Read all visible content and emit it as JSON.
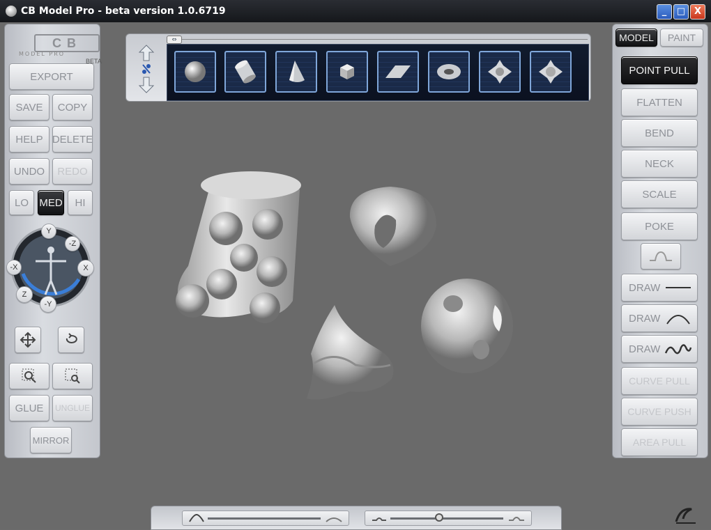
{
  "window": {
    "title": "CB Model Pro - beta version 1.0.6719",
    "controls": [
      "_",
      "□",
      "X"
    ]
  },
  "logo": {
    "brand": "CB",
    "subtitle": "MODEL PRO",
    "badge": "BETA"
  },
  "left_panel": {
    "export": "EXPORT",
    "save": "SAVE",
    "copy": "COPY",
    "help": "HELP",
    "delete": "DELETE",
    "undo": "UNDO",
    "redo": "REDO",
    "lo": "LO",
    "med": "MED",
    "hi": "HI",
    "axes": {
      "y": "Y",
      "neg_z": "-Z",
      "neg_x": "-X",
      "x": "X",
      "z": "Z",
      "neg_y": "-Y"
    },
    "glue": "GLUE",
    "unglue": "UNGLUE",
    "mirror": "MIRROR"
  },
  "right_panel": {
    "tab_model": "MODEL",
    "tab_paint": "PAINT",
    "tools": {
      "point_pull": "POINT PULL",
      "flatten": "FLATTEN",
      "bend": "BEND",
      "neck": "NECK",
      "scale": "SCALE",
      "poke": "POKE",
      "draw_line": "DRAW",
      "draw_arc": "DRAW",
      "draw_wave": "DRAW",
      "curve_pull": "CURVE PULL",
      "curve_push": "CURVE PUSH",
      "area_pull": "AREA PULL"
    }
  },
  "primitives": [
    "sphere-icon",
    "cylinder-icon",
    "cone-icon",
    "cube-icon",
    "plane-icon",
    "torus-icon",
    "gear-a-icon",
    "gear-b-icon"
  ],
  "colors": {
    "accent_blue": "#7fa6d9",
    "background": "#6b6b6b",
    "active_button": "#111214"
  },
  "sliders": {
    "brush_size": 0.0,
    "brush_strength": 0.43
  }
}
